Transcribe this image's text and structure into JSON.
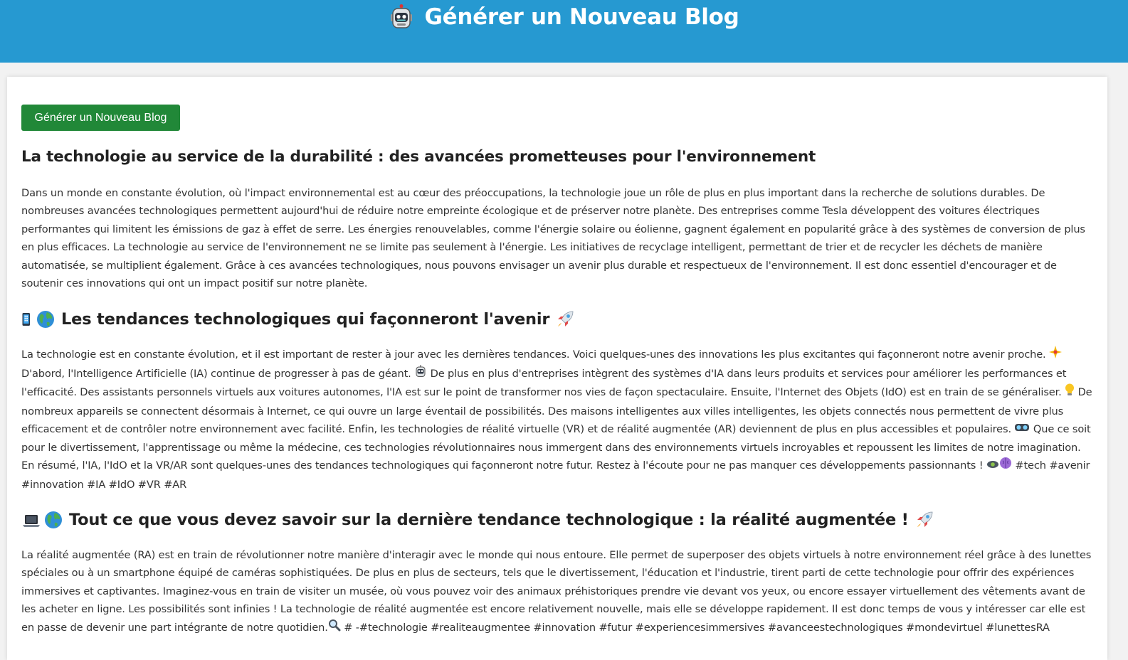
{
  "header": {
    "title": "Générer un Nouveau Blog",
    "icon": "robot-icon"
  },
  "toolbar": {
    "generate_label": "Générer un Nouveau Blog"
  },
  "colors": {
    "header_bg": "#2699d1",
    "button_bg": "#218838",
    "page_bg": "#f2f2f2"
  },
  "article1": {
    "title": "La technologie au service de la durabilité : des avancées prometteuses pour l'environnement",
    "body": "Dans un monde en constante évolution, où l'impact environnemental est au cœur des préoccupations, la technologie joue un rôle de plus en plus important dans la recherche de solutions durables. De nombreuses avancées technologiques permettent aujourd'hui de réduire notre empreinte écologique et de préserver notre planète. Des entreprises comme Tesla développent des voitures électriques performantes qui limitent les émissions de gaz à effet de serre. Les énergies renouvelables, comme l'énergie solaire ou éolienne, gagnent également en popularité grâce à des systèmes de conversion de plus en plus efficaces. La technologie au service de l'environnement ne se limite pas seulement à l'énergie. Les initiatives de recyclage intelligent, permettant de trier et de recycler les déchets de manière automatisée, se multiplient également. Grâce à ces avancées technologiques, nous pouvons envisager un avenir plus durable et respectueux de l'environnement. Il est donc essentiel d'encourager et de soutenir ces innovations qui ont un impact positif sur notre planète."
  },
  "article2": {
    "title": "Les tendances technologiques qui façonneront l'avenir",
    "icons": [
      "smartphone-icon",
      "globe-icon",
      "rocket-icon"
    ],
    "body_parts": [
      "La technologie est en constante évolution, et il est important de rester à jour avec les dernières tendances. Voici quelques-unes des innovations les plus excitantes qui façonneront notre avenir proche. ",
      " D'abord, l'Intelligence Artificielle (IA) continue de progresser à pas de géant. ",
      " De plus en plus d'entreprises intègrent des systèmes d'IA dans leurs produits et services pour améliorer les performances et l'efficacité. Des assistants personnels virtuels aux voitures autonomes, l'IA est sur le point de transformer nos vies de façon spectaculaire. Ensuite, l'Internet des Objets (IdO) est en train de se généraliser. ",
      " De nombreux appareils se connectent désormais à Internet, ce qui ouvre un large éventail de possibilités. Des maisons intelligentes aux villes intelligentes, les objets connectés nous permettent de vivre plus efficacement et de contrôler notre environnement avec facilité. Enfin, les technologies de réalité virtuelle (VR) et de réalité augmentée (AR) deviennent de plus en plus accessibles et populaires. ",
      " Que ce soit pour le divertissement, l'apprentissage ou même la médecine, ces technologies révolutionnaires nous immergent dans des environnements virtuels incroyables et repoussent les limites de notre imagination. En résumé, l'IA, l'IdO et la VR/AR sont quelques-unes des tendances technologiques qui façonneront notre futur. Restez à l'écoute pour ne pas manquer ces développements passionnants ! ",
      " #tech #avenir #innovation #IA #IdO #VR #AR"
    ],
    "inline_icons": [
      "sparkle-icon",
      "robot-icon",
      "lightbulb-icon",
      "vr-goggles-icon",
      "satellite-icon",
      "brain-icon"
    ]
  },
  "article3": {
    "title": "Tout ce que vous devez savoir sur la dernière tendance technologique : la réalité augmentée !",
    "icons": [
      "laptop-icon",
      "globe-icon",
      "rocket-icon"
    ],
    "body": "La réalité augmentée (RA) est en train de révolutionner notre manière d'interagir avec le monde qui nous entoure. Elle permet de superposer des objets virtuels à notre environnement réel grâce à des lunettes spéciales ou à un smartphone équipé de caméras sophistiquées. De plus en plus de secteurs, tels que le divertissement, l'éducation et l'industrie, tirent parti de cette technologie pour offrir des expériences immersives et captivantes. Imaginez-vous en train de visiter un musée, où vous pouvez voir des animaux préhistoriques prendre vie devant vos yeux, ou encore essayer virtuellement des vêtements avant de les acheter en ligne. Les possibilités sont infinies ! La technologie de réalité augmentée est encore relativement nouvelle, mais elle se développe rapidement. Il est donc temps de vous y intéresser car elle est en passe de devenir une part intégrante de notre quotidien.",
    "tail_icon": "magnifier-icon",
    "tags": " # -#technologie #realiteaugmentee #innovation #futur #experiencesimmersives #avanceestechnologiques #mondevirtuel #lunettesRA"
  }
}
